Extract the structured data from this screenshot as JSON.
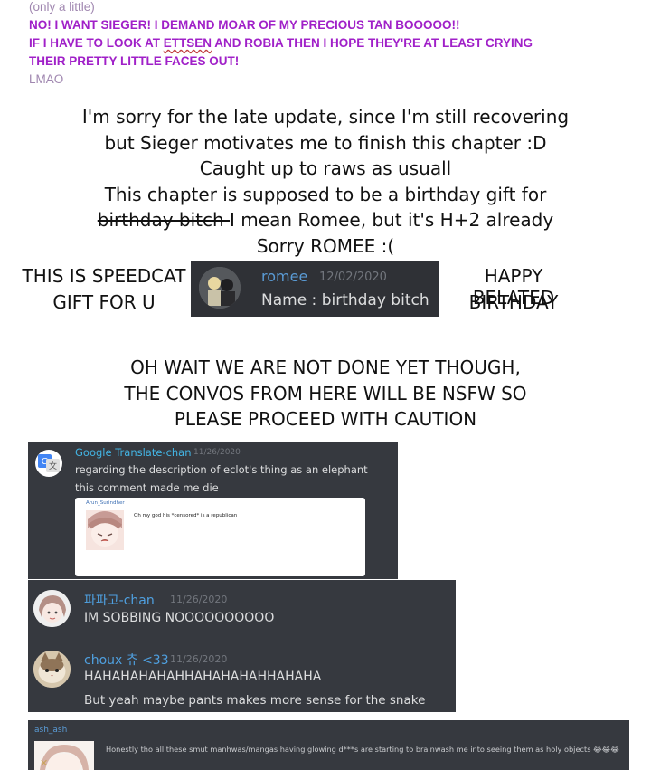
{
  "header_notes": {
    "line1": "(only a little)",
    "line2": "NO! I WANT SIEGER! I DEMAND MOAR OF MY PRECIOUS TAN BOOOOO!!",
    "line3_pre": "IF I HAVE TO LOOK AT ",
    "line3_word": "ETTSEN",
    "line3_post": " AND ROBIA THEN I HOPE THEY'RE AT LEAST CRYING",
    "line4": "THEIR PRETTY LITTLE FACES OUT!",
    "line5": "LMAO"
  },
  "author_note": {
    "l1": "I'm sorry for the late update, since I'm still recovering",
    "l2": "but Sieger motivates me to finish this chapter :D",
    "l3": "Caught up to raws as usuall",
    "l4": "This chapter is supposed to be a birthday gift for",
    "l5_strike": "birthday bitch ",
    "l5_rest": "I mean Romee, but it's H+2 already",
    "l6": "Sorry ROMEE :("
  },
  "gift": {
    "left_1": "THIS IS SPEEDCAT",
    "left_2": "GIFT FOR U",
    "right_1": "HAPPY BELATED",
    "right_2": "BIRTHDAY",
    "card_name": "romee",
    "card_date": "12/02/2020",
    "card_text": "Name : birthday bitch"
  },
  "warning": {
    "l1": "OH WAIT WE ARE NOT DONE YET THOUGH,",
    "l2": "THE CONVOS FROM HERE WILL BE NSFW SO",
    "l3": "PLEASE PROCEED WITH CAUTION"
  },
  "chat1": {
    "name": "Google Translate-chan",
    "time": "11/26/2020",
    "msg1": "regarding the description of eclot's thing as an elephant",
    "msg2": "this comment made me die",
    "embed_user": "Arun_Surindher",
    "embed_text": "Oh my god his *censored* is a republican"
  },
  "chat2": {
    "m1_name": "파파고-chan",
    "m1_time": "11/26/2020",
    "m1_text": "IM SOBBING NOOOOOOOOOO",
    "m2_name": "choux 츄 <33",
    "m2_time": "11/26/2020",
    "m2_text1": "HAHAHAHAHAHHAHAHAHAHHAHAHA",
    "m2_text2": "But yeah maybe pants makes more sense for the snake"
  },
  "chat3": {
    "name": "ash_ash",
    "text": "Honestly tho all these smut manhwas/mangas having glowing d***s are starting to brainwash me into seeing them as holy objects",
    "emoji": "😂😂😂"
  },
  "colors": {
    "purple": "#a020c8",
    "discord_bg": "#36393f",
    "name_blue": "#5a9bd5",
    "name_teal": "#43b5e5"
  }
}
